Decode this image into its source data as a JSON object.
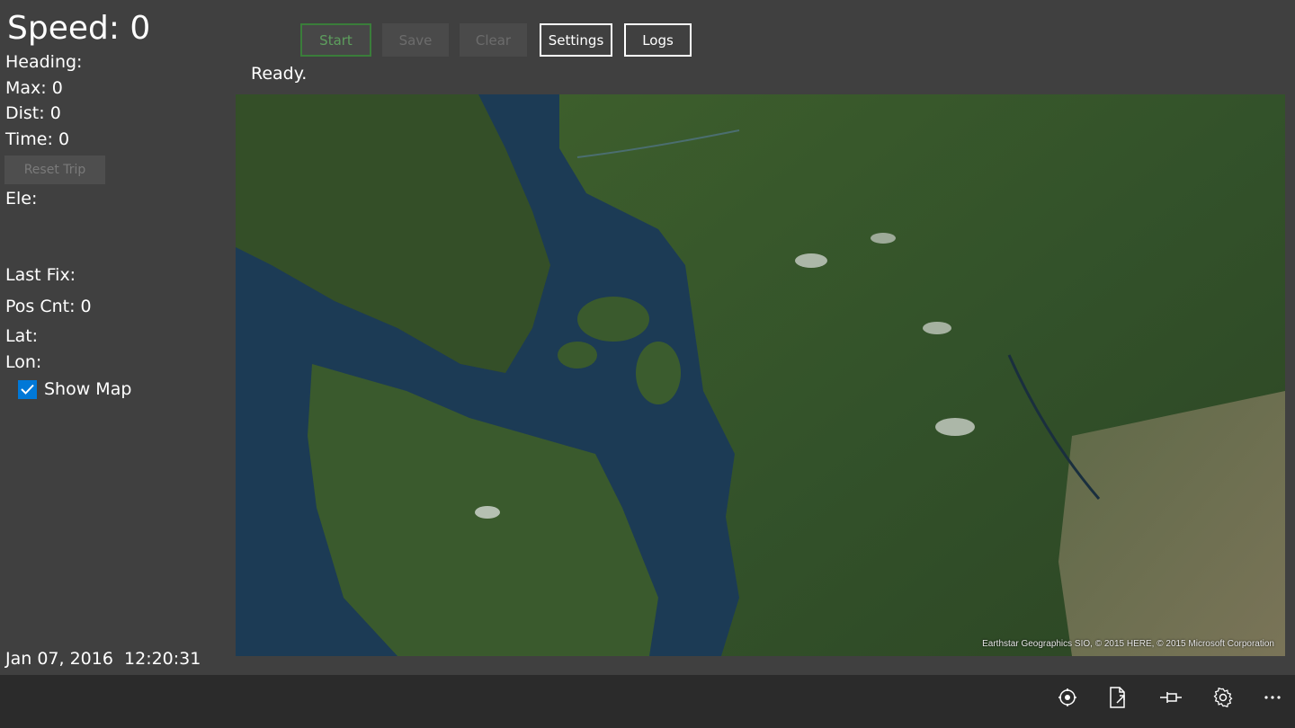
{
  "stats": {
    "speed": "Speed: 0",
    "heading": "Heading:",
    "max": "Max: 0",
    "dist": "Dist: 0",
    "time": "Time: 0",
    "reset_trip": "Reset Trip",
    "ele": "Ele:",
    "last_fix": "Last Fix:",
    "pos_cnt": "Pos Cnt: 0",
    "lat": "Lat:",
    "lon": "Lon:"
  },
  "show_map": {
    "label": "Show Map",
    "checked": true
  },
  "datetime": "Jan 07, 2016  12:20:31",
  "toolbar": {
    "start": "Start",
    "save": "Save",
    "clear": "Clear",
    "settings": "Settings",
    "logs": "Logs"
  },
  "status": "Ready.",
  "map": {
    "copyright": "Earthstar Geographics  SIO, © 2015 HERE, © 2015 Microsoft Corporation"
  },
  "appbar": {
    "icons": [
      "locate-icon",
      "export-icon",
      "pin-icon",
      "gear-icon",
      "more-icon"
    ]
  },
  "colors": {
    "background": "#404040",
    "appbar": "#2b2b2b",
    "checkbox": "#0078d7",
    "start_border": "#3a7d3a"
  }
}
